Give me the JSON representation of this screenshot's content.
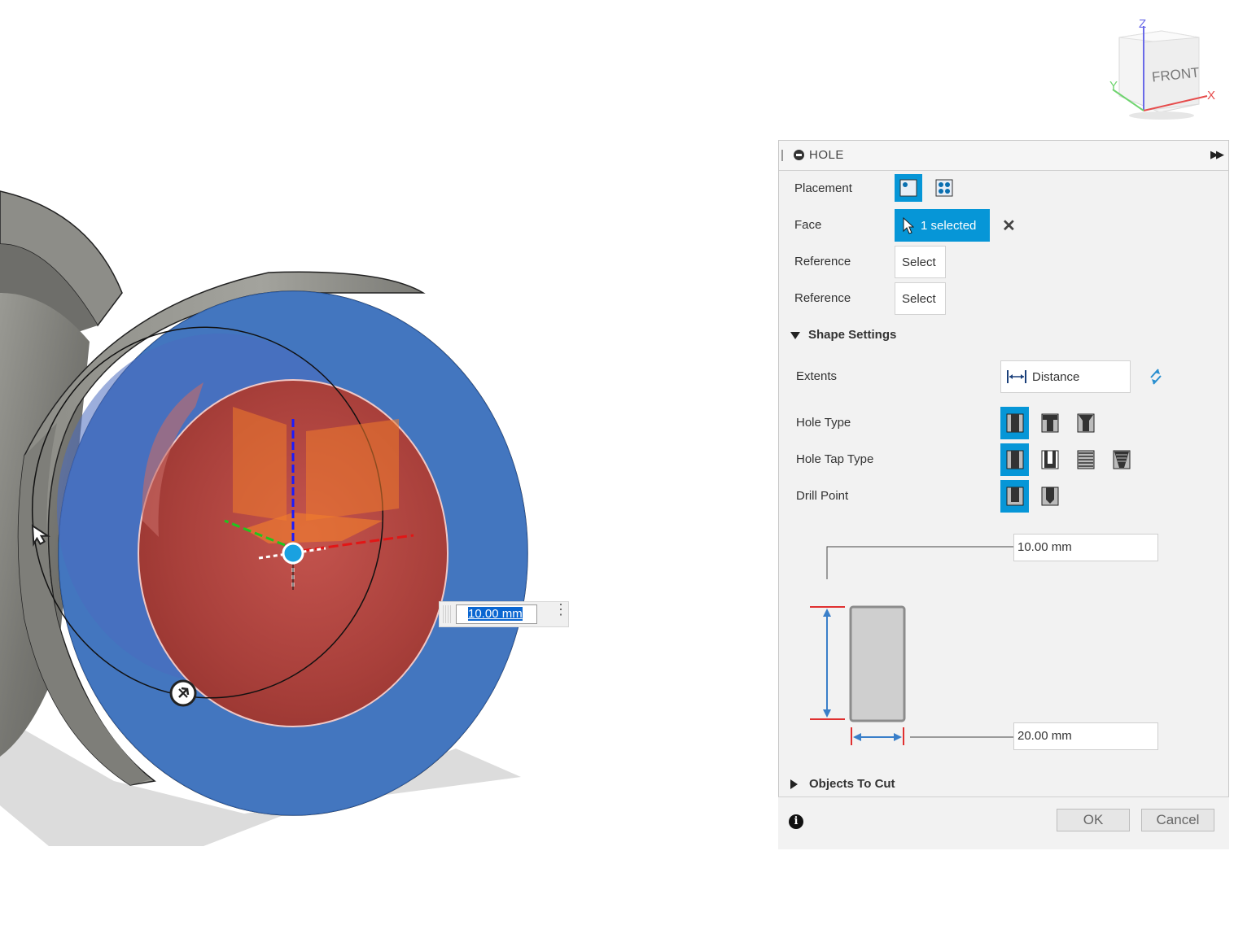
{
  "canvas": {
    "dimension_input_value": "10.00 mm"
  },
  "viewcube": {
    "face_label": "FRONT",
    "axis_z": "Z",
    "axis_x": "X",
    "axis_y": "Y"
  },
  "panel": {
    "title": "HOLE",
    "placement_label": "Placement",
    "face_label": "Face",
    "face_value": "1 selected",
    "reference1_label": "Reference",
    "reference1_value": "Select",
    "reference2_label": "Reference",
    "reference2_value": "Select",
    "shape_settings_label": "Shape Settings",
    "extents_label": "Extents",
    "extents_value": "Distance",
    "hole_type_label": "Hole Type",
    "hole_tap_type_label": "Hole Tap Type",
    "drill_point_label": "Drill Point",
    "depth_value": "10.00 mm",
    "diameter_value": "20.00 mm",
    "objects_to_cut_label": "Objects To Cut",
    "ok_label": "OK",
    "cancel_label": "Cancel"
  },
  "colors": {
    "accent": "#0696d7",
    "face_blue": "#4376bf",
    "hole_red": "#b54a44",
    "body_gray": "#8f8f89"
  }
}
